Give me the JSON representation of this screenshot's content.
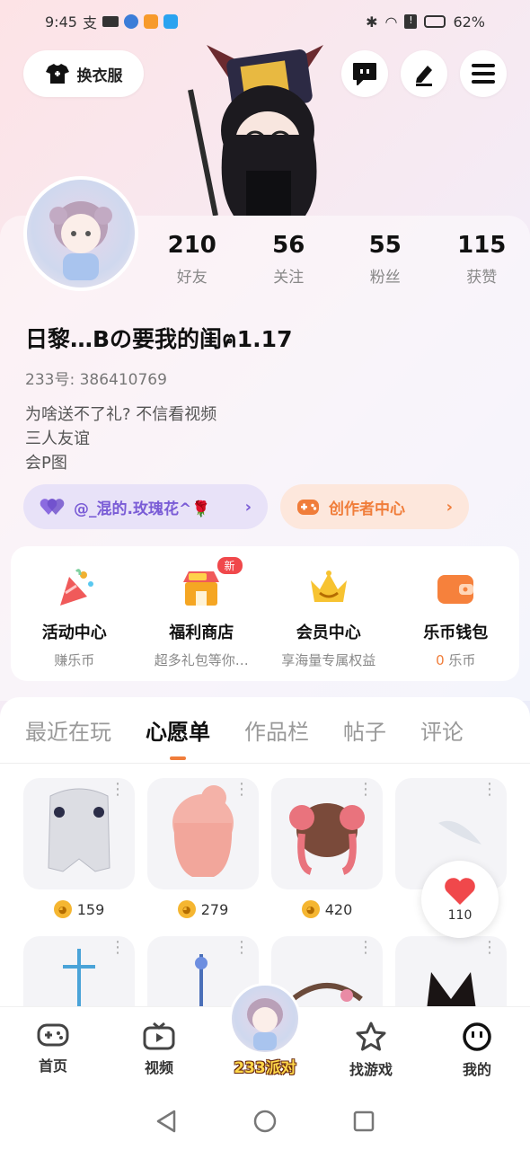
{
  "status_bar": {
    "time": "9:45",
    "carrier_glyph": "支",
    "battery": "62%"
  },
  "top": {
    "dress_label": "换衣服"
  },
  "profile": {
    "stats": [
      {
        "num": "210",
        "label": "好友"
      },
      {
        "num": "56",
        "label": "关注"
      },
      {
        "num": "55",
        "label": "粉丝"
      },
      {
        "num": "115",
        "label": "获赞"
      }
    ],
    "nickname": "日黎…Bの要我的闺ฅ1.17",
    "uid": "233号: 386410769",
    "bio": [
      "为啥送不了礼? 不信看视频",
      "三人友谊",
      "会P图"
    ]
  },
  "pills": {
    "friend_label": "@_混的.玫瑰花^🌹",
    "creator_label": "创作者中心"
  },
  "features": [
    {
      "title": "活动中心",
      "sub": "赚乐币",
      "sub_highlight": ""
    },
    {
      "title": "福利商店",
      "sub": "超多礼包等你…",
      "sub_highlight": "",
      "badge": "新"
    },
    {
      "title": "会员中心",
      "sub": "享海量专属权益",
      "sub_highlight": ""
    },
    {
      "title": "乐币钱包",
      "sub": "乐币",
      "sub_highlight": "0"
    }
  ],
  "tabs": [
    "最近在玩",
    "心愿单",
    "作品栏",
    "帖子",
    "评论"
  ],
  "active_tab": 1,
  "items": [
    {
      "price": "159"
    },
    {
      "price": "279"
    },
    {
      "price": "420"
    },
    {
      "price": ""
    }
  ],
  "heart": {
    "count": "110"
  },
  "bottom_nav": [
    {
      "label": "首页"
    },
    {
      "label": "视频"
    },
    {
      "label": "233派对"
    },
    {
      "label": "找游戏"
    },
    {
      "label": "我的"
    }
  ],
  "colors": {
    "accent": "#f07d3a",
    "purple": "#7a5cd6",
    "heart": "#f0484b"
  }
}
